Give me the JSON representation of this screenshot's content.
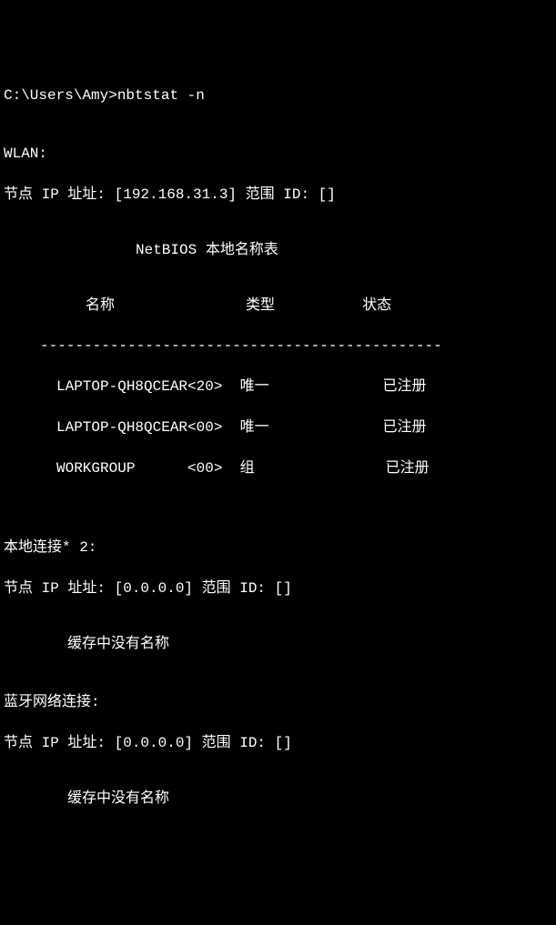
{
  "prompt": {
    "path": "C:\\Users\\Amy>",
    "command": "nbtstat -n"
  },
  "interfaces": [
    {
      "name": "WLAN:",
      "node_line": "节点 IP 址址: [192.168.31.3] 范围 ID: []",
      "has_table": true,
      "table": {
        "title": "NetBIOS 本地名称表",
        "headers": {
          "name": "名称",
          "type": "类型",
          "status": "状态"
        },
        "divider": "----------------------------------------------",
        "rows": [
          {
            "line": "LAPTOP-QH8QCEAR<20>  唯一             已注册"
          },
          {
            "line": "LAPTOP-QH8QCEAR<00>  唯一             已注册"
          },
          {
            "line": "WORKGROUP      <00>  组               已注册"
          }
        ]
      }
    },
    {
      "name": "本地连接* 2:",
      "node_line": "节点 IP 址址: [0.0.0.0] 范围 ID: []",
      "has_table": false,
      "no_cache": "缓存中没有名称"
    },
    {
      "name": "蓝牙网络连接:",
      "node_line": "节点 IP 址址: [0.0.0.0] 范围 ID: []",
      "has_table": false,
      "no_cache": "缓存中没有名称"
    }
  ]
}
